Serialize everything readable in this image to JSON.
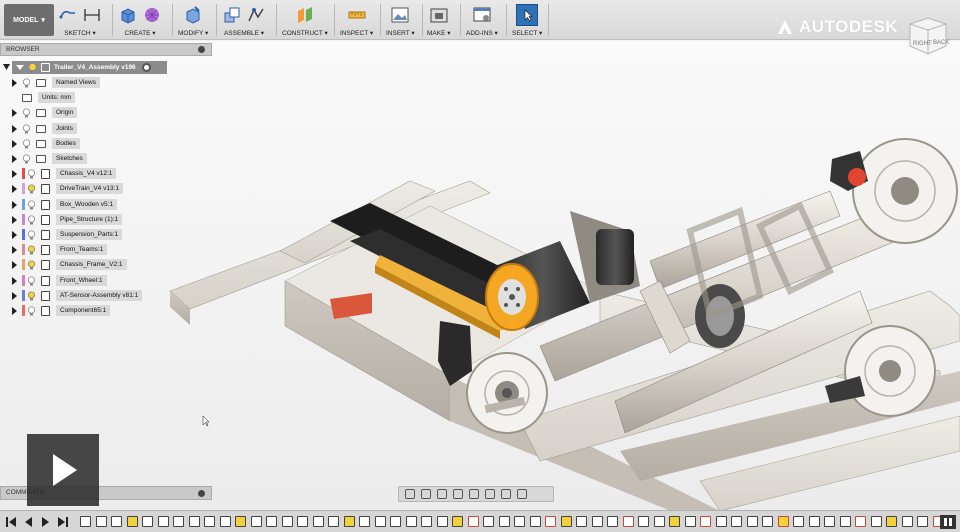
{
  "workspace": {
    "label": "MODEL"
  },
  "toolbar": {
    "groups": [
      {
        "label": "SKETCH"
      },
      {
        "label": "CREATE"
      },
      {
        "label": "MODIFY"
      },
      {
        "label": "ASSEMBLE"
      },
      {
        "label": "CONSTRUCT"
      },
      {
        "label": "INSPECT"
      },
      {
        "label": "INSERT"
      },
      {
        "label": "MAKE"
      },
      {
        "label": "ADD-INS"
      },
      {
        "label": "SELECT"
      }
    ]
  },
  "brand": {
    "name": "AUTODESK"
  },
  "viewcube": {
    "right": "RIGHT",
    "back": "BACK"
  },
  "browser": {
    "title": "BROWSER",
    "root": "Trailer_V4_Assembly v196",
    "items": [
      {
        "label": "Named Views",
        "type": "folder",
        "tag": ""
      },
      {
        "label": "Units: mm",
        "type": "units",
        "tag": ""
      },
      {
        "label": "Origin",
        "type": "folder",
        "tag": ""
      },
      {
        "label": "Joints",
        "type": "folder",
        "tag": ""
      },
      {
        "label": "Bodies",
        "type": "folder",
        "tag": ""
      },
      {
        "label": "Sketches",
        "type": "folder",
        "tag": ""
      },
      {
        "label": "Chassis_V4 v12:1",
        "type": "component",
        "tag": "#e04a4a"
      },
      {
        "label": "DriveTrain_V4 v13:1",
        "type": "component",
        "tag": "#d9a0d6"
      },
      {
        "label": "Box_Wooden v5:1",
        "type": "component",
        "tag": "#6fa0e0"
      },
      {
        "label": "Pipe_Structure (1):1",
        "type": "component",
        "tag": "#c48ad8"
      },
      {
        "label": "Suspension_Parts:1",
        "type": "component",
        "tag": "#5a6fd8"
      },
      {
        "label": "From_Teams:1",
        "type": "component",
        "tag": "#e08a8a"
      },
      {
        "label": "Chassis_Frame_V2:1",
        "type": "component",
        "tag": "#f0a070"
      },
      {
        "label": "Front_Wheel:1",
        "type": "component",
        "tag": "#d680c0"
      },
      {
        "label": "AT-Sensor-Assembly v81:1",
        "type": "component",
        "tag": "#6a7fe0"
      },
      {
        "label": "Component65:1",
        "type": "component",
        "tag": "#e86a6a"
      }
    ]
  },
  "comments": {
    "title": "COMMENTS"
  }
}
